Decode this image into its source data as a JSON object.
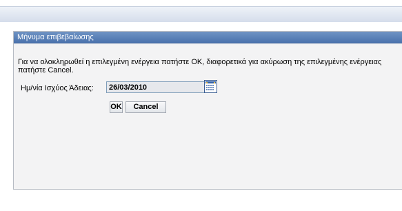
{
  "dialog": {
    "title": "Μήνυμα επιβεβαίωσης",
    "message": "Για να ολοκληρωθεί η επιλεγμένη ενέργεια πατήστε ΟΚ, διαφορετικά για ακύρωση της επιλεγμένης ενέργειας πατήστε Cancel.",
    "date_label": "Ημ/νία Ισχύος Άδειας:",
    "date_value": "26/03/2010",
    "ok_label": "OK",
    "cancel_label": "Cancel"
  },
  "colors": {
    "header": "#4a72ad",
    "input_border": "#7f9db9",
    "dialog_bg": "#f3f3f4"
  },
  "icons": {
    "calendar": "calendar-icon"
  }
}
